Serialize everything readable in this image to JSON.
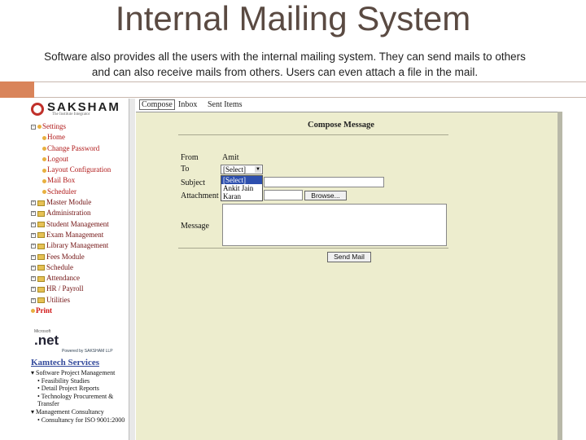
{
  "slide": {
    "title": "Internal Mailing System",
    "description": "Software also provides all the users with the internal mailing system. They can send mails to others and can also receive mails from others. Users can even attach a file in the mail."
  },
  "colors": {
    "accent": "#d9845a",
    "brand_red": "#c0302a",
    "panel_bg": "#ededce",
    "selection": "#2d4fae"
  },
  "app": {
    "logo": {
      "text": "SAKSHAM",
      "subtitle": "The Institute Integrator"
    },
    "tree": [
      {
        "label": "Settings",
        "kind": "root"
      },
      {
        "label": "Home",
        "kind": "child"
      },
      {
        "label": "Change Password",
        "kind": "child"
      },
      {
        "label": "Logout",
        "kind": "child"
      },
      {
        "label": "Layout Configuration",
        "kind": "child"
      },
      {
        "label": "Mail Box",
        "kind": "child"
      },
      {
        "label": "Scheduler",
        "kind": "child"
      },
      {
        "label": "Master Module",
        "kind": "module"
      },
      {
        "label": "Administration",
        "kind": "module"
      },
      {
        "label": "Student Management",
        "kind": "module"
      },
      {
        "label": "Exam Management",
        "kind": "module"
      },
      {
        "label": "Library Management",
        "kind": "module"
      },
      {
        "label": "Fees Module",
        "kind": "module"
      },
      {
        "label": "Schedule",
        "kind": "module"
      },
      {
        "label": "Attendance",
        "kind": "module"
      },
      {
        "label": "HR / Payroll",
        "kind": "module"
      },
      {
        "label": "Utilities",
        "kind": "module"
      },
      {
        "label": "Print",
        "kind": "print"
      }
    ],
    "net_badge": {
      "ms": "Microsoft",
      "logo": ".net",
      "by": "Powered by SAKSHAM LLP"
    },
    "kamtech": "Kamtech Services",
    "links": [
      {
        "text": "▾ Software Project Management",
        "indent": false
      },
      {
        "text": "• Feasibility Studies",
        "indent": true
      },
      {
        "text": "• Detail Project Reports",
        "indent": true
      },
      {
        "text": "• Technology Procurement &",
        "indent": true
      },
      {
        "text": "Transfer",
        "indent": true
      },
      {
        "text": "▾ Management Consultancy",
        "indent": false
      },
      {
        "text": "• Consultancy for ISO 9001:2000",
        "indent": true
      }
    ],
    "tabs": [
      "Compose",
      "Inbox",
      "Sent Items"
    ],
    "compose": {
      "title": "Compose Message",
      "from_label": "From",
      "from_value": "Amit",
      "to_label": "To",
      "to_selected": "[Select]",
      "to_options": [
        "[Select]",
        "Ankit Jain",
        "Karan"
      ],
      "subject_label": "Subject",
      "attachment_label": "Attachment",
      "browse_label": "Browse...",
      "message_label": "Message",
      "send_label": "Send Mail"
    }
  }
}
